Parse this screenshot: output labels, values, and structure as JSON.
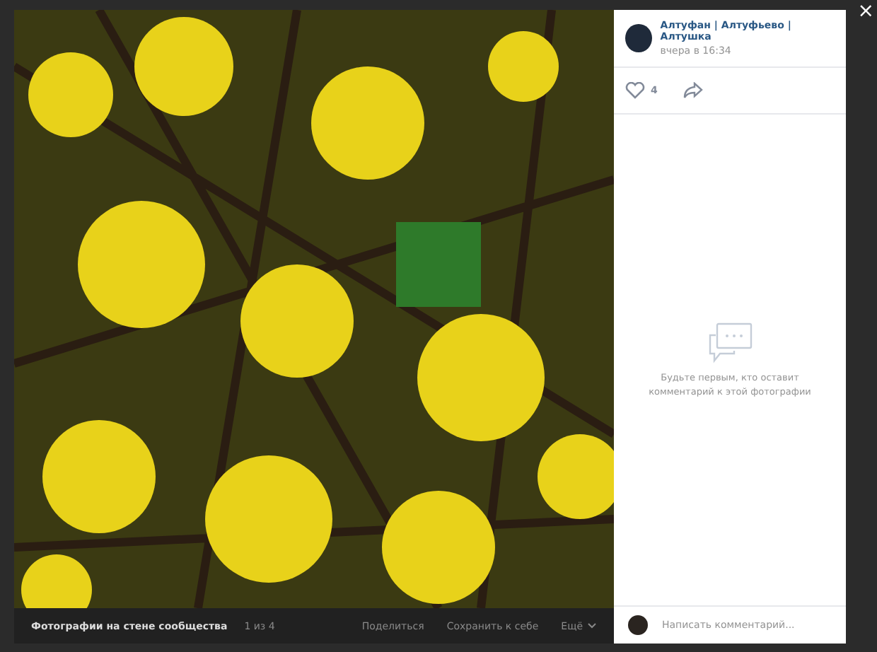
{
  "photo": {
    "caption": "Фотографии на стене сообщества",
    "counter": "1 из 4",
    "actions": [
      "Поделиться",
      "Сохранить к себе",
      "Ещё"
    ]
  },
  "close": "×",
  "post": {
    "author": "Алтуфан | Алтуфьево | Алтушка",
    "time": "вчера в 16:34",
    "likes": "4",
    "liked": false
  },
  "comments": {
    "empty": "Будьте первым, кто оставит комментарий к этой фотографии",
    "placeholder": "Написать комментарий..."
  }
}
